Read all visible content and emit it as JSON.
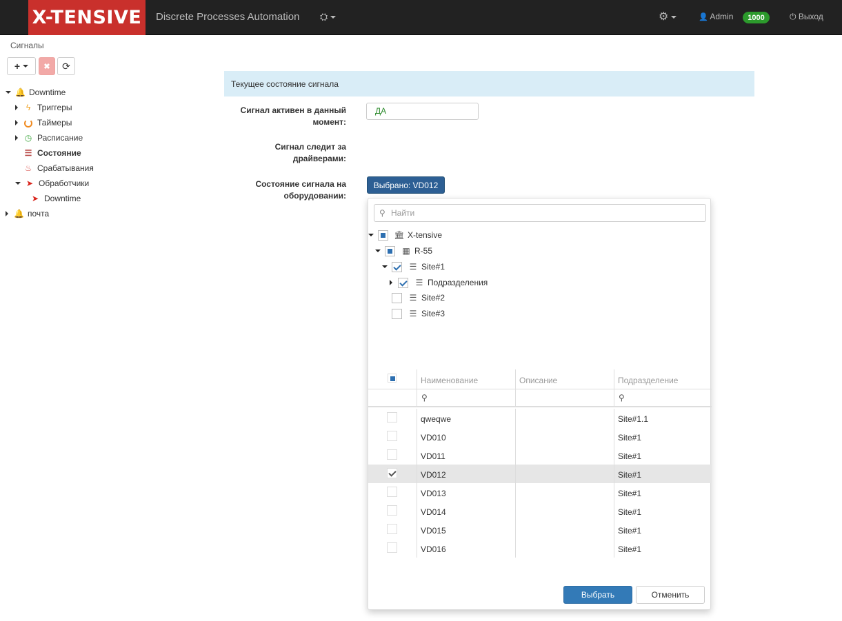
{
  "navbar": {
    "brand": "X-TENSIVE",
    "app_title": "Discrete Processes Automation",
    "cubes_icon": "cubes-icon",
    "settings_icon": "gear-icon",
    "user": "Admin",
    "badge": "1000",
    "logout": "Выход",
    "colors": {
      "navbar_bg": "#222222",
      "brand_bg": "#c9302c",
      "badge_bg": "#2c9a2c"
    }
  },
  "sidebar": {
    "title": "Сигналы",
    "toolbar": {
      "add": "+",
      "delete": "✖",
      "refresh": "⟳"
    },
    "tree": [
      {
        "label": "Downtime",
        "icon": "bell-icon"
      },
      {
        "label": "Триггеры",
        "icon": "bolt-icon"
      },
      {
        "label": "Таймеры",
        "icon": "timer-icon"
      },
      {
        "label": "Расписание",
        "icon": "clock-icon"
      },
      {
        "label": "Состояние",
        "icon": "list-icon"
      },
      {
        "label": "Срабатывания",
        "icon": "fire-icon"
      },
      {
        "label": "Обработчики",
        "icon": "paper-plane-icon"
      },
      {
        "label": "Downtime",
        "icon": "paper-plane-icon"
      },
      {
        "label": "почта",
        "icon": "bell-icon"
      }
    ]
  },
  "main": {
    "panel_title": "Текущее состояние сигнала",
    "fields": [
      {
        "label": "Сигнал активен в данный момент:",
        "value": "ДА"
      },
      {
        "label": "Сигнал следит за драйверами:"
      },
      {
        "label": "Состояние сигнала на оборудовании:",
        "button": "Выбрано: VD012"
      }
    ]
  },
  "dropdown": {
    "search_placeholder": "Найти",
    "tree": [
      {
        "label": "X-tensive",
        "icon": "bank-icon",
        "state": "partial"
      },
      {
        "label": "R-55",
        "icon": "building-icon",
        "state": "partial"
      },
      {
        "label": "Site#1",
        "icon": "sitemap-icon",
        "state": "checked"
      },
      {
        "label": "Подразделения",
        "icon": "sitemap-icon",
        "state": "checked"
      },
      {
        "label": "Site#2",
        "icon": "sitemap-icon",
        "state": "unchecked"
      },
      {
        "label": "Site#3",
        "icon": "sitemap-icon",
        "state": "unchecked"
      }
    ],
    "grid": {
      "columns": [
        "Наименование",
        "Описание",
        "Подразделение"
      ],
      "rows": [
        {
          "name": "qweqwe",
          "desc": "",
          "dept": "Site#1.1",
          "checked": false
        },
        {
          "name": "VD010",
          "desc": "",
          "dept": "Site#1",
          "checked": false
        },
        {
          "name": "VD011",
          "desc": "",
          "dept": "Site#1",
          "checked": false
        },
        {
          "name": "VD012",
          "desc": "",
          "dept": "Site#1",
          "checked": true
        },
        {
          "name": "VD013",
          "desc": "",
          "dept": "Site#1",
          "checked": false
        },
        {
          "name": "VD014",
          "desc": "",
          "dept": "Site#1",
          "checked": false
        },
        {
          "name": "VD015",
          "desc": "",
          "dept": "Site#1",
          "checked": false
        },
        {
          "name": "VD016",
          "desc": "",
          "dept": "Site#1",
          "checked": false
        }
      ]
    },
    "buttons": {
      "select": "Выбрать",
      "cancel": "Отменить"
    }
  }
}
